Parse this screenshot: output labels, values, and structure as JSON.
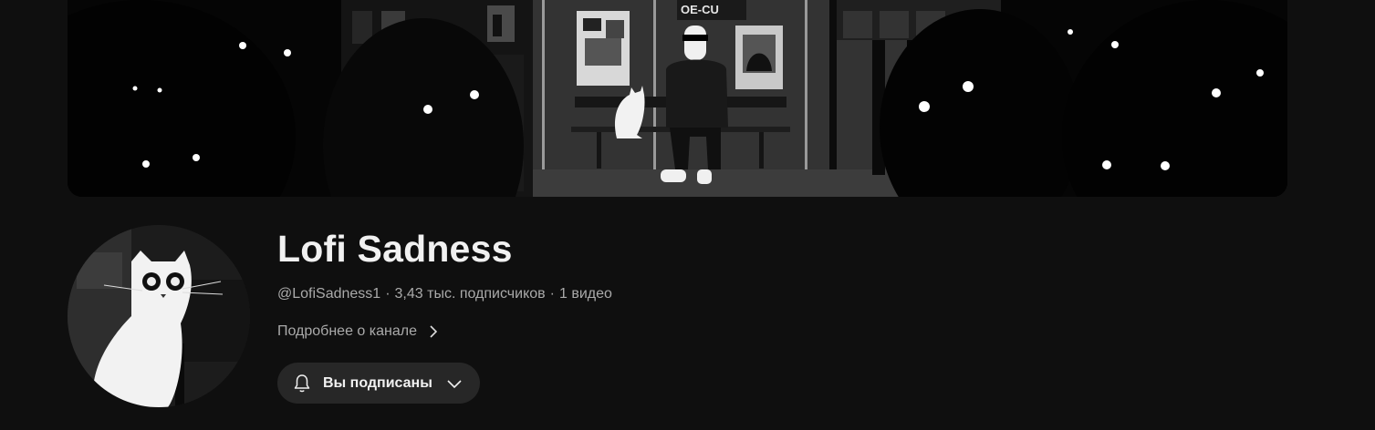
{
  "channel": {
    "name": "Lofi Sadness",
    "handle": "@LofiSadness1",
    "separator": "·",
    "subscribers": "3,43 тыс. подписчиков",
    "videos": "1 видео",
    "about_link": "Подробнее о канале"
  },
  "subscribe_button": {
    "label": "Вы подписаны",
    "bell_icon": "bell-icon",
    "dropdown_icon": "chevron-down-icon"
  },
  "banner": {
    "sign_text": "OE-CU"
  },
  "colors": {
    "background": "#0f0f0f",
    "title_text": "#f1f1f1",
    "secondary_text": "#aaaaaa",
    "button_bg": "#272727"
  }
}
